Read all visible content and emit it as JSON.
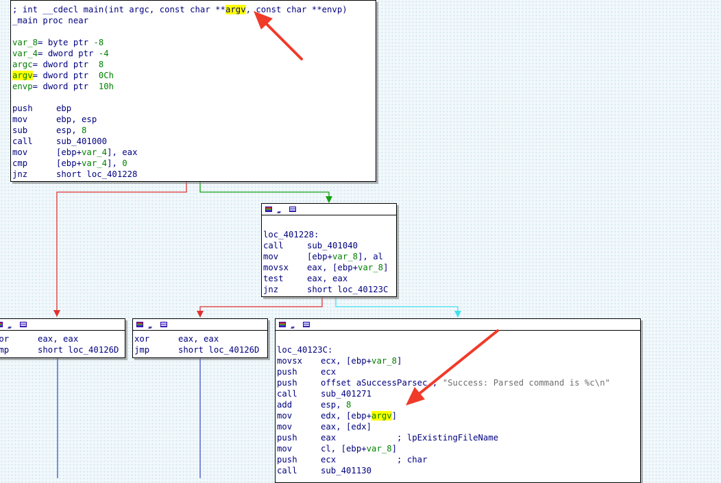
{
  "main_block": {
    "header_line": [
      "; int __cdecl main(int argc, const char **",
      "argv",
      ", const char **envp)"
    ],
    "proc_line": "_main proc near",
    "vars": [
      {
        "name": "var_8",
        "sep": "= ",
        "decl": "byte ptr ",
        "val": "-8"
      },
      {
        "name": "var_4",
        "sep": "= ",
        "decl": "dword ptr ",
        "val": "-4"
      },
      {
        "name": "argc",
        "sep": "= ",
        "decl": "dword ptr  ",
        "val": "8"
      },
      {
        "name": "argv",
        "sep": "= ",
        "decl": "dword ptr  ",
        "val": "0Ch"
      },
      {
        "name": "envp",
        "sep": "= ",
        "decl": "dword ptr  ",
        "val": "10h"
      }
    ],
    "instructions": [
      {
        "op": "push",
        "args": "ebp"
      },
      {
        "op": "mov",
        "args": "ebp, esp"
      },
      {
        "op": "sub",
        "a1": "esp, ",
        "num": "8"
      },
      {
        "op": "call",
        "args": "sub_401000"
      },
      {
        "op": "mov",
        "a1": "[ebp+",
        "var": "var_4",
        "a2": "], eax"
      },
      {
        "op": "cmp",
        "a1": "[ebp+",
        "var": "var_4",
        "a2": "], ",
        "num": "0"
      },
      {
        "op": "jnz",
        "args": "short loc_401228"
      }
    ]
  },
  "loc_401228_block": {
    "label": "loc_401228:",
    "instructions": [
      {
        "op": "call",
        "args": "sub_401040"
      },
      {
        "op": "mov",
        "a1": "[ebp+",
        "var": "var_8",
        "a2": "], al"
      },
      {
        "op": "movsx",
        "a1": "eax, [ebp+",
        "var": "var_8",
        "a2": "]"
      },
      {
        "op": "test",
        "args": "eax, eax"
      },
      {
        "op": "jnz",
        "args": "short loc_40123C"
      }
    ]
  },
  "left_block_1": {
    "instructions": [
      {
        "op": "xor",
        "args": "eax, eax"
      },
      {
        "op": "jmp",
        "args": "short loc_40126D"
      }
    ]
  },
  "left_block_2": {
    "instructions": [
      {
        "op": "xor",
        "args": "eax, eax"
      },
      {
        "op": "jmp",
        "args": "short loc_40126D"
      }
    ]
  },
  "loc_40123C_block": {
    "label": "loc_40123C:",
    "instructions": [
      {
        "op": "movsx",
        "a1": "ecx, [ebp+",
        "var": "var_8",
        "a2": "]"
      },
      {
        "op": "push",
        "args": "ecx"
      },
      {
        "op": "push",
        "args": "offset aSuccessParsec",
        "comment": " ; ",
        "str": "\"Success: Parsed command is %c\\n\""
      },
      {
        "op": "call",
        "args": "sub_401271"
      },
      {
        "op": "add",
        "a1": "esp, ",
        "num": "8"
      },
      {
        "op": "mov",
        "a1": "edx, [ebp+",
        "hl": "argv",
        "a2": "]"
      },
      {
        "op": "mov",
        "args": "eax, [edx]"
      },
      {
        "op": "push",
        "args": "eax",
        "comment": "            ; lpExistingFileName"
      },
      {
        "op": "mov",
        "a1": "cl, [ebp+",
        "var": "var_8",
        "a2": "]"
      },
      {
        "op": "push",
        "args": "ecx",
        "comment": "            ; char"
      },
      {
        "op": "call",
        "args": "sub_401130"
      }
    ]
  },
  "colors": {
    "edge_false": "#e03030",
    "edge_true": "#10a010",
    "edge_uncond": "#40e0f0",
    "edge_flow": "#4050d0",
    "annotation_arrow": "#f03a2a",
    "highlight": "#ffff00"
  },
  "icons": [
    "graph-color-icon",
    "graph-node-icon",
    "graph-listing-icon"
  ]
}
